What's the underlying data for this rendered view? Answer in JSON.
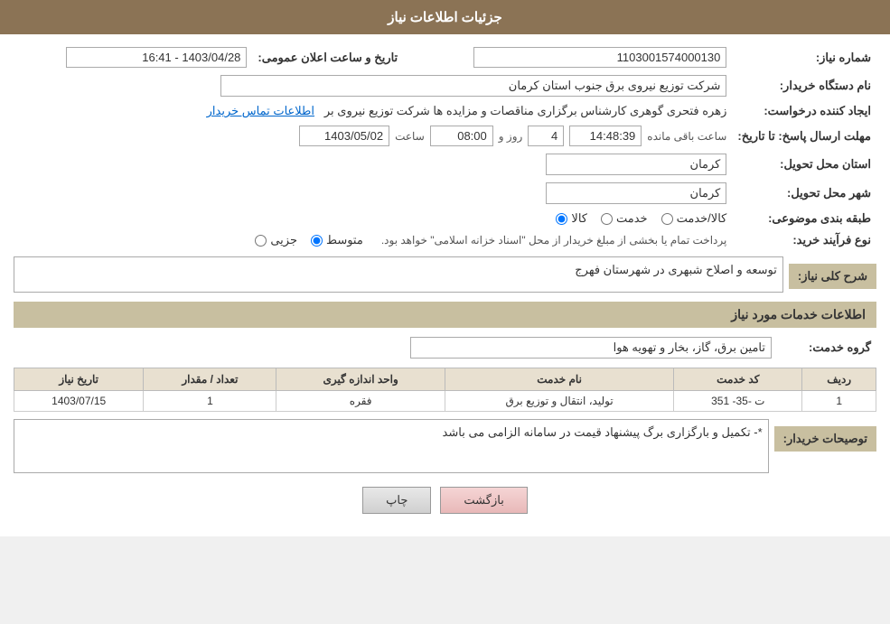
{
  "page": {
    "title": "جزئیات اطلاعات نیاز"
  },
  "header": {
    "title": "جزئیات اطلاعات نیاز"
  },
  "fields": {
    "order_number_label": "شماره نیاز:",
    "order_number_value": "1103001574000130",
    "announcement_date_label": "تاریخ و ساعت اعلان عمومی:",
    "announcement_date_value": "1403/04/28 - 16:41",
    "buyer_org_label": "نام دستگاه خریدار:",
    "buyer_org_value": "شرکت توزیع نیروی برق جنوب استان کرمان",
    "requester_label": "ایجاد کننده درخواست:",
    "requester_value": "زهره فتحری گوهری کارشناس برگزاری مناقصات و مزایده ها شرکت توزیع نیروی بر",
    "requester_link": "اطلاعات تماس خریدار",
    "deadline_label": "مهلت ارسال پاسخ: تا تاریخ:",
    "deadline_date": "1403/05/02",
    "deadline_time_label": "ساعت",
    "deadline_time": "08:00",
    "deadline_days_label": "روز و",
    "deadline_days": "4",
    "deadline_remaining_label": "ساعت باقی مانده",
    "deadline_remaining": "14:48:39",
    "province_label": "استان محل تحویل:",
    "province_value": "کرمان",
    "city_label": "شهر محل تحویل:",
    "city_value": "کرمان",
    "category_label": "طبقه بندی موضوعی:",
    "category_options": [
      "کالا",
      "خدمت",
      "کالا/خدمت"
    ],
    "category_selected": "کالا",
    "process_label": "نوع فرآیند خرید:",
    "process_options": [
      "جزیی",
      "متوسط"
    ],
    "process_selected": "متوسط",
    "process_note": "پرداخت تمام یا بخشی از مبلغ خریدار از محل \"اسناد خزانه اسلامی\" خواهد بود.",
    "description_section_label": "شرح کلی نیاز:",
    "description_value": "توسعه و اصلاح شبهری در شهرستان فهرج",
    "services_section_label": "اطلاعات خدمات مورد نیاز",
    "service_group_label": "گروه خدمت:",
    "service_group_value": "تامین برق، گاز، بخار و تهویه هوا",
    "table_headers": [
      "ردیف",
      "کد خدمت",
      "نام خدمت",
      "واحد اندازه گیری",
      "تعداد / مقدار",
      "تاریخ نیاز"
    ],
    "table_rows": [
      {
        "row": "1",
        "code": "ت -35- 351",
        "name": "تولید، انتقال و توزیع برق",
        "unit": "فقره",
        "quantity": "1",
        "date": "1403/07/15"
      }
    ],
    "buyer_notes_label": "توصیحات خریدار:",
    "buyer_notes_value": "*- تکمیل و بارگزاری برگ پیشنهاد قیمت در سامانه الزامی می باشد",
    "btn_print": "چاپ",
    "btn_back": "بازگشت"
  }
}
